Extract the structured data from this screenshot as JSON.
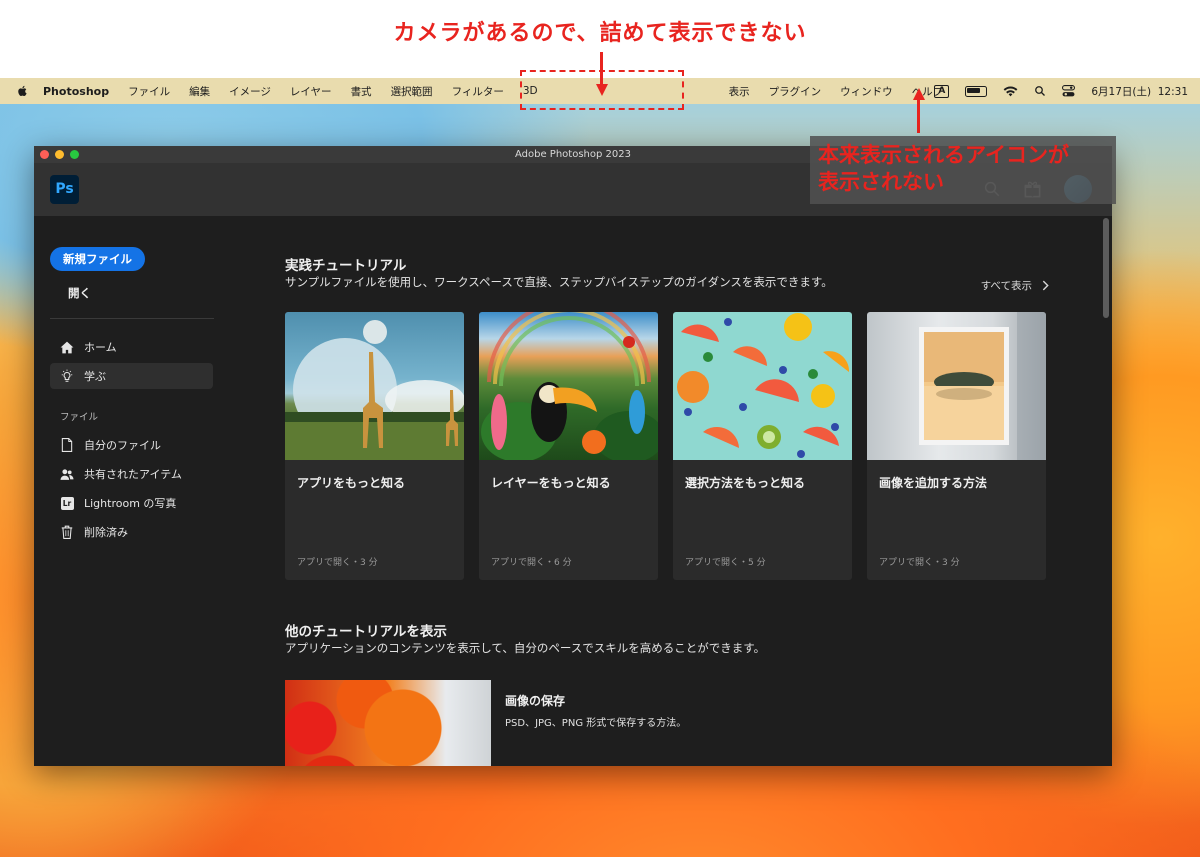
{
  "annotations": {
    "top_note": "カメラがあるので、詰めて表示できない",
    "side_note_line1": "本来表示されるアイコンが",
    "side_note_line2": "表示されない",
    "accent_color": "#e8241f"
  },
  "menubar": {
    "app_name": "Photoshop",
    "items_left": [
      "ファイル",
      "編集",
      "イメージ",
      "レイヤー",
      "書式",
      "選択範囲",
      "フィルター",
      "3D"
    ],
    "items_right": [
      "表示",
      "プラグイン",
      "ウィンドウ",
      "ヘルプ"
    ],
    "ime": "A",
    "datetime": "6月17日(土)  12:31"
  },
  "window": {
    "title": "Adobe Photoshop 2023",
    "logo": "Ps"
  },
  "sidebar": {
    "new_file": "新規ファイル",
    "open": "開く",
    "nav": [
      {
        "label": "ホーム",
        "icon": "home-icon"
      },
      {
        "label": "学ぶ",
        "icon": "lightbulb-icon"
      }
    ],
    "section_label": "ファイル",
    "files": [
      {
        "label": "自分のファイル",
        "icon": "document-icon"
      },
      {
        "label": "共有されたアイテム",
        "icon": "people-icon"
      },
      {
        "label": "Lightroom の写真",
        "icon": "lightroom-icon",
        "badge": "Lr"
      },
      {
        "label": "削除済み",
        "icon": "trash-icon"
      }
    ]
  },
  "main": {
    "section1_title": "実践チュートリアル",
    "section1_desc": "サンプルファイルを使用し、ワークスペースで直接、ステップバイステップのガイダンスを表示できます。",
    "see_all": "すべて表示",
    "cards": [
      {
        "title": "アプリをもっと知る",
        "meta": "アプリで開く・3 分"
      },
      {
        "title": "レイヤーをもっと知る",
        "meta": "アプリで開く・6 分"
      },
      {
        "title": "選択方法をもっと知る",
        "meta": "アプリで開く・5 分"
      },
      {
        "title": "画像を追加する方法",
        "meta": "アプリで開く・3 分"
      }
    ],
    "section2_title": "他のチュートリアルを表示",
    "section2_desc": "アプリケーションのコンテンツを表示して、自分のペースでスキルを高めることができます。",
    "list": [
      {
        "title": "画像の保存",
        "desc": "PSD、JPG、PNG 形式で保存する方法。"
      }
    ]
  }
}
